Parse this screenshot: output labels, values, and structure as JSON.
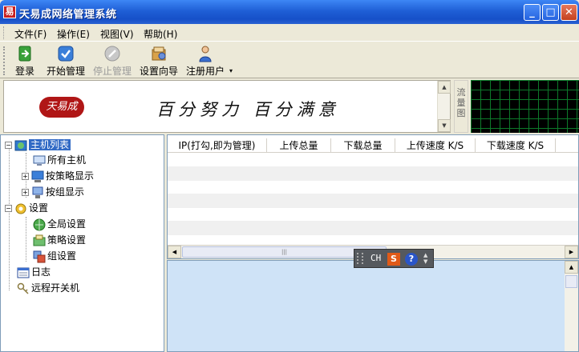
{
  "window": {
    "title": "天易成网络管理系统",
    "app_icon_glyph": "易",
    "controls": {
      "minimize": "_",
      "maximize": "□",
      "close": "✕"
    }
  },
  "menu": {
    "items": [
      {
        "label": "文件(F)"
      },
      {
        "label": "操作(E)"
      },
      {
        "label": "视图(V)"
      },
      {
        "label": "帮助(H)"
      }
    ]
  },
  "toolbar": {
    "buttons": [
      {
        "label": "登录",
        "icon": "login-icon",
        "enabled": true
      },
      {
        "label": "开始管理",
        "icon": "start-check-icon",
        "enabled": true
      },
      {
        "label": "停止管理",
        "icon": "stop-icon",
        "enabled": false
      },
      {
        "label": "设置向导",
        "icon": "wizard-icon",
        "enabled": true
      },
      {
        "label": "注册用户",
        "icon": "user-icon",
        "enabled": true
      }
    ],
    "more_arrow": "▾"
  },
  "banner": {
    "logo_text": "天易成",
    "slogan": "百分努力 百分满意",
    "scroll_up": "▲",
    "scroll_down": "▼"
  },
  "traffic": {
    "label": "流量图"
  },
  "tree": {
    "nodes": [
      {
        "label": "主机列表",
        "selected": true
      },
      {
        "label": "所有主机"
      },
      {
        "label": "按策略显示"
      },
      {
        "label": "按组显示"
      },
      {
        "label": "设置"
      },
      {
        "label": "全局设置"
      },
      {
        "label": "策略设置"
      },
      {
        "label": "组设置"
      },
      {
        "label": "日志"
      },
      {
        "label": "远程开关机"
      }
    ],
    "expand_minus": "−",
    "expand_plus": "+"
  },
  "table": {
    "columns": [
      "IP(打勾,即为管理)",
      "上传总量",
      "下载总量",
      "上传速度 K/S",
      "下载速度 K/S"
    ],
    "scroll_left": "◀",
    "scroll_right": "▶",
    "thumb_grip": "|||"
  },
  "ime": {
    "lang": "CH",
    "s_label": "S",
    "help_label": "?"
  },
  "colors": {
    "titlebar": "#1f5fd6",
    "selection": "#316ac5",
    "log_background": "#cfe3f7",
    "traffic_grid": "#0d7a2a"
  }
}
